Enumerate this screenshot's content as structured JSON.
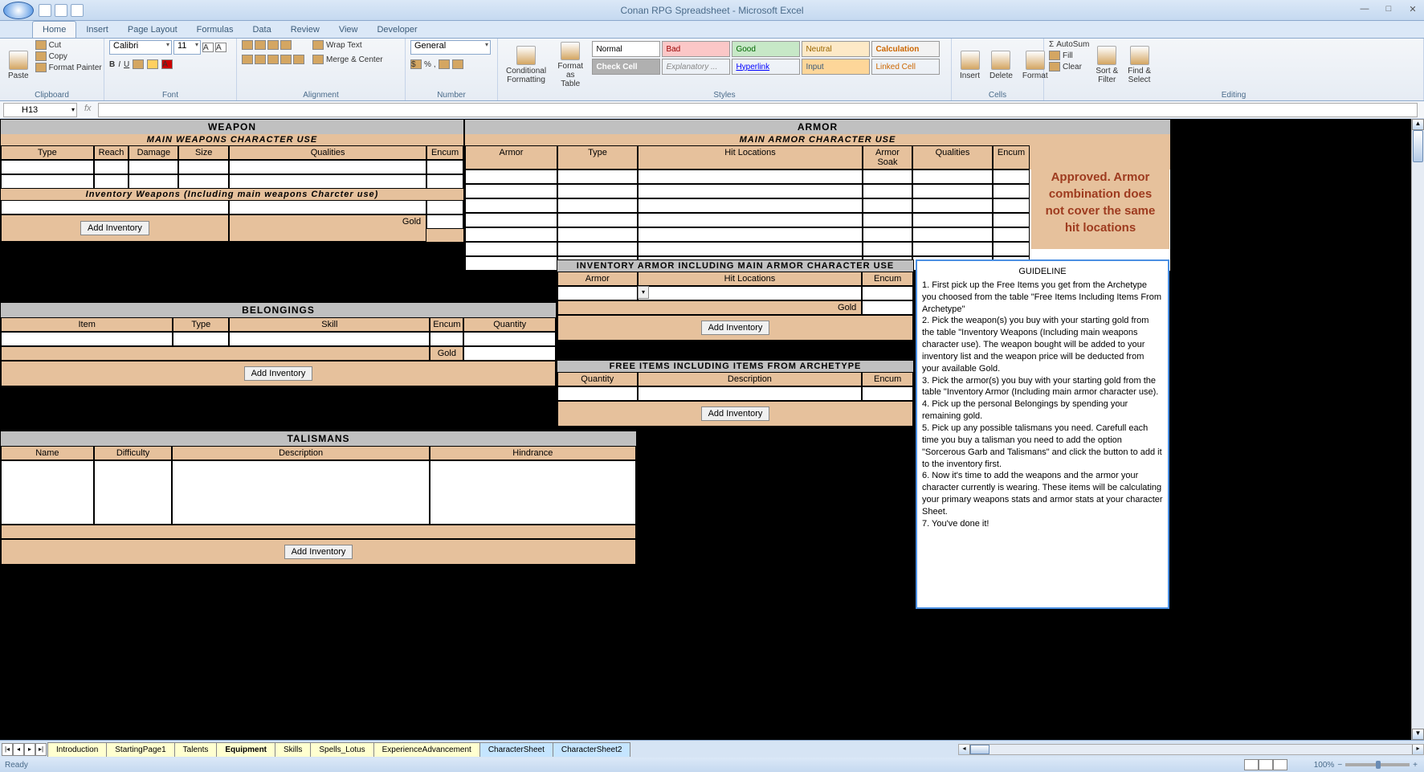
{
  "window": {
    "title": "Conan RPG Spreadsheet - Microsoft Excel"
  },
  "tabs": [
    "Home",
    "Insert",
    "Page Layout",
    "Formulas",
    "Data",
    "Review",
    "View",
    "Developer"
  ],
  "clipboard": {
    "paste": "Paste",
    "cut": "Cut",
    "copy": "Copy",
    "format_painter": "Format Painter",
    "label": "Clipboard"
  },
  "font": {
    "name": "Calibri",
    "size": "11",
    "label": "Font"
  },
  "alignment": {
    "wrap": "Wrap Text",
    "merge": "Merge & Center",
    "label": "Alignment"
  },
  "number": {
    "format": "General",
    "label": "Number"
  },
  "styles": {
    "cf": "Conditional\nFormatting",
    "fat": "Format\nas Table",
    "label": "Styles",
    "cells": {
      "normal": "Normal",
      "bad": "Bad",
      "good": "Good",
      "neutral": "Neutral",
      "calculation": "Calculation",
      "check": "Check Cell",
      "explan": "Explanatory ...",
      "hyper": "Hyperlink",
      "input": "Input",
      "linked": "Linked Cell"
    }
  },
  "cells_grp": {
    "insert": "Insert",
    "delete": "Delete",
    "format": "Format",
    "label": "Cells"
  },
  "editing": {
    "autosum": "AutoSum",
    "fill": "Fill",
    "clear": "Clear",
    "sort": "Sort &\nFilter",
    "find": "Find &\nSelect",
    "label": "Editing"
  },
  "namebox": "H13",
  "sheet": {
    "weapon": {
      "title": "WEAPON",
      "sub": "MAIN WEAPONS CHARACTER USE",
      "cols": [
        "Type",
        "Reach",
        "Damage",
        "Size",
        "Qualities",
        "Encum"
      ],
      "inv_title": "Inventory Weapons (Including main weapons Charcter use)",
      "gold": "Gold",
      "addbtn": "Add Inventory"
    },
    "armor": {
      "title": "ARMOR",
      "sub": "MAIN ARMOR CHARACTER USE",
      "cols": [
        "Armor",
        "Type",
        "Hit Locations",
        "Armor Soak",
        "Qualities",
        "Encum"
      ],
      "approved": "Approved. Armor combination does not cover the same hit locations"
    },
    "inv_armor": {
      "title": "INVENTORY ARMOR  INCLUDING MAIN ARMOR CHARACTER USE",
      "cols": [
        "Armor",
        "Hit Locations",
        "Encum"
      ],
      "gold": "Gold",
      "addbtn": "Add Inventory"
    },
    "free": {
      "title": "FREE ITEMS  INCLUDING ITEMS FROM ARCHETYPE",
      "cols": [
        "Quantity",
        "Description",
        "Encum"
      ],
      "addbtn": "Add Inventory"
    },
    "belong": {
      "title": "BELONGINGS",
      "cols": [
        "Item",
        "Type",
        "Skill",
        "Encum",
        "Quantity"
      ],
      "gold": "Gold",
      "addbtn": "Add Inventory"
    },
    "talis": {
      "title": "TALISMANS",
      "cols": [
        "Name",
        "Difficulty",
        "Description",
        "Hindrance"
      ],
      "addbtn": "Add Inventory"
    },
    "guide": {
      "title": "GUIDELINE",
      "lines": [
        "1. First pick up the Free Items you get from the Archetype you choosed from the table \"Free Items Including Items From Archetype\"",
        "2. Pick the weapon(s) you buy with your starting gold from the table \"Inventory Weapons (Including main weapons character use). The weapon bought will be added to your inventory list and the weapon price will be deducted from your available Gold.",
        "3. Pick the armor(s) you buy with your starting gold from the table \"Inventory Armor (Including main armor character use).",
        "4. Pick up the personal Belongings by spending your remaining gold.",
        "5. Pick up any possible talismans you need. Carefull each time you buy a talisman you need to add the option \"Sorcerous Garb and Talismans\" and click the button to add it to the inventory first.",
        "6. Now it's time to add the weapons and the armor your character currently is wearing. These items will be calculating your primary weapons stats and armor stats at your character Sheet.",
        "7. You've done it!"
      ]
    }
  },
  "sheet_tabs": [
    "Introduction",
    "StartingPage1",
    "Talents",
    "Equipment",
    "Skills",
    "Spells_Lotus",
    "ExperienceAdvancement",
    "CharacterSheet",
    "CharacterSheet2"
  ],
  "status": {
    "ready": "Ready",
    "zoom": "100%"
  }
}
